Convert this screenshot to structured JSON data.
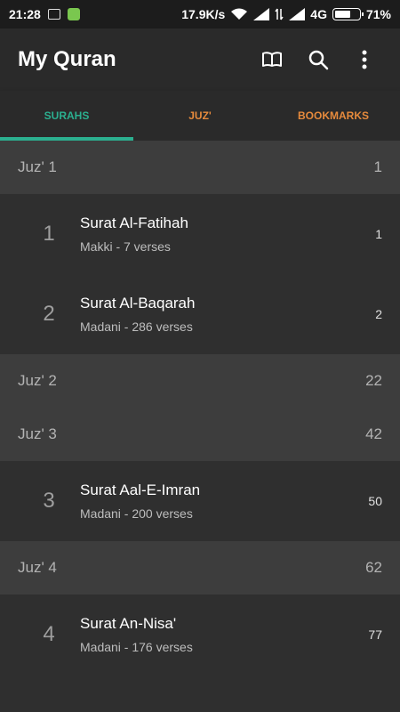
{
  "status_bar": {
    "time": "21:28",
    "speed": "17.9K/s",
    "network": "4G",
    "battery": "71%",
    "battery_level": 0.71
  },
  "app_bar": {
    "title": "My Quran",
    "icons": [
      "book-icon",
      "search-icon",
      "more-vert-icon"
    ]
  },
  "tabs": [
    {
      "label": "SURAHS",
      "color": "#2baf8f",
      "active": true
    },
    {
      "label": "JUZ'",
      "color": "#e68a3c",
      "active": false
    },
    {
      "label": "BOOKMARKS",
      "color": "#e68a3c",
      "active": false
    }
  ],
  "rows": [
    {
      "type": "juz",
      "label": "Juz' 1",
      "page": "1"
    },
    {
      "type": "surah",
      "number": "1",
      "name": "Surat Al-Fatihah",
      "meta": "Makki - 7 verses",
      "page": "1"
    },
    {
      "type": "surah",
      "number": "2",
      "name": "Surat Al-Baqarah",
      "meta": "Madani - 286 verses",
      "page": "2"
    },
    {
      "type": "juz",
      "label": "Juz' 2",
      "page": "22"
    },
    {
      "type": "juz",
      "label": "Juz' 3",
      "page": "42"
    },
    {
      "type": "surah",
      "number": "3",
      "name": "Surat Aal-E-Imran",
      "meta": "Madani - 200 verses",
      "page": "50"
    },
    {
      "type": "juz",
      "label": "Juz' 4",
      "page": "62"
    },
    {
      "type": "surah",
      "number": "4",
      "name": "Surat An-Nisa'",
      "meta": "Madani - 176 verses",
      "page": "77"
    }
  ]
}
